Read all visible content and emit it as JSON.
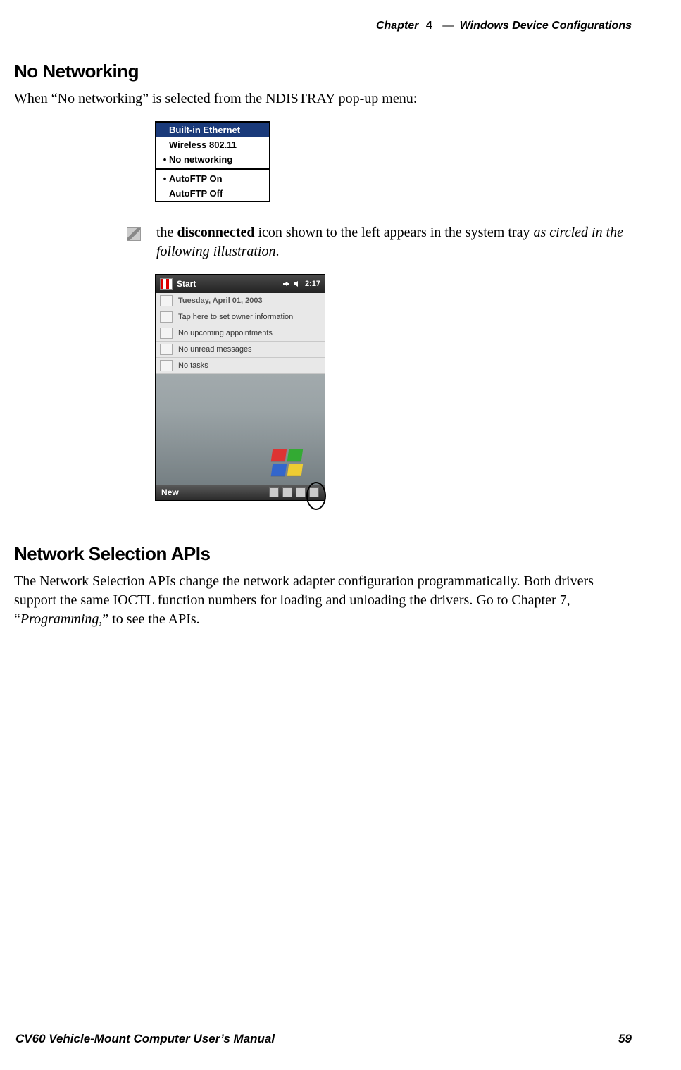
{
  "header": {
    "chapter_word": "Chapter",
    "chapter_num": "4",
    "separator": "—",
    "chapter_title": "Windows Device Configurations"
  },
  "section1": {
    "heading": "No Networking",
    "intro": "When “No networking” is selected from the NDISTRAY pop-up menu:"
  },
  "popup_menu": {
    "items": [
      {
        "label": "Built-in Ethernet",
        "selected": true,
        "bullet": false
      },
      {
        "label": "Wireless 802.11",
        "selected": false,
        "bullet": false
      },
      {
        "label": "No networking",
        "selected": false,
        "bullet": true
      }
    ],
    "items2": [
      {
        "label": "AutoFTP On",
        "bullet": true
      },
      {
        "label": "AutoFTP Off",
        "bullet": false
      }
    ]
  },
  "icon_para": {
    "t1": "the ",
    "bold": "disconnected",
    "t2": " icon shown to the left appears in the system tray ",
    "ital": "as circled in the following illustration",
    "t3": "."
  },
  "pda": {
    "start": "Start",
    "time": "2:17",
    "rows": [
      "Tuesday, April 01, 2003",
      "Tap here to set owner information",
      "No upcoming appointments",
      "No unread messages",
      "No tasks"
    ],
    "new": "New"
  },
  "section2": {
    "heading": "Network Selection APIs",
    "body_1": "The Network Selection APIs change the network adapter configuration programmatically. Both drivers support the same IOCTL function numbers for loading and unloading the drivers. Go to Chapter 7, “",
    "body_ital": "Programming",
    "body_2": ",” to see the APIs."
  },
  "footer": {
    "left": "CV60 Vehicle-Mount Computer User’s Manual",
    "right": "59"
  }
}
